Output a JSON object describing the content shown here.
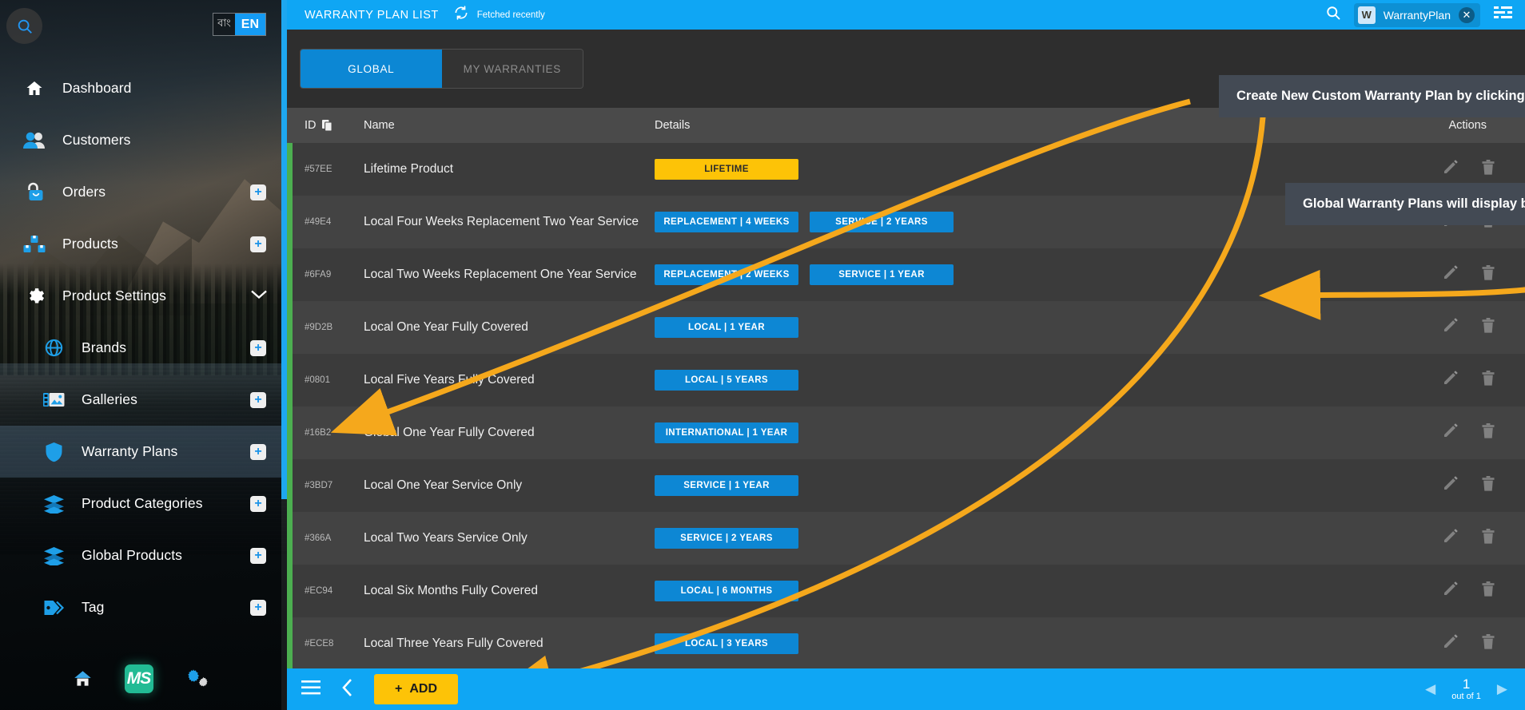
{
  "sidebar": {
    "search_icon": "search-icon",
    "language": {
      "alt_label": "বাং",
      "current": "EN"
    },
    "items": [
      {
        "label": "Dashboard",
        "icon": "home-icon",
        "add": false,
        "chevron": false,
        "sub": false,
        "active": false
      },
      {
        "label": "Customers",
        "icon": "customers-icon",
        "add": false,
        "chevron": false,
        "sub": false,
        "active": false
      },
      {
        "label": "Orders",
        "icon": "orders-icon",
        "add": true,
        "chevron": false,
        "sub": false,
        "active": false
      },
      {
        "label": "Products",
        "icon": "products-icon",
        "add": true,
        "chevron": false,
        "sub": false,
        "active": false
      },
      {
        "label": "Product Settings",
        "icon": "gear-icon",
        "add": false,
        "chevron": true,
        "sub": false,
        "active": false
      },
      {
        "label": "Brands",
        "icon": "globe-icon",
        "add": true,
        "chevron": false,
        "sub": true,
        "active": false
      },
      {
        "label": "Galleries",
        "icon": "gallery-icon",
        "add": true,
        "chevron": false,
        "sub": true,
        "active": false
      },
      {
        "label": "Warranty Plans",
        "icon": "shield-icon",
        "add": true,
        "chevron": false,
        "sub": true,
        "active": true
      },
      {
        "label": "Product Categories",
        "icon": "layers-icon",
        "add": true,
        "chevron": false,
        "sub": true,
        "active": false
      },
      {
        "label": "Global Products",
        "icon": "layers-icon",
        "add": true,
        "chevron": false,
        "sub": true,
        "active": false
      },
      {
        "label": "Tag",
        "icon": "tag-icon",
        "add": true,
        "chevron": false,
        "sub": true,
        "active": false
      }
    ],
    "plus_label": "+",
    "footer": {
      "home_icon": "home-icon",
      "brand_logo": "MS",
      "settings_icon": "double-gear-icon"
    }
  },
  "topbar": {
    "title": "WARRANTY PLAN LIST",
    "refresh_icon": "refresh-icon",
    "status": "Fetched recently",
    "search_icon": "search-icon",
    "account": {
      "initial": "W",
      "name": "WarrantyPlan",
      "close_label": "✕"
    },
    "menu_icon": "filter-list-icon",
    "accent_color": "#0fa6f4"
  },
  "tabs": [
    {
      "label": "GLOBAL",
      "active": true
    },
    {
      "label": "MY WARRANTIES",
      "active": false
    }
  ],
  "table": {
    "columns": [
      "ID",
      "Name",
      "Details",
      "Actions"
    ],
    "id_copy_icon": "copy-icon",
    "edit_icon": "pencil-icon",
    "delete_icon": "trash-icon",
    "row_accent_color": "#4caf50",
    "badge_color": "#0d87d4",
    "badge_gold_color": "#fdc307",
    "rows": [
      {
        "id": "#57EE",
        "name": "Lifetime Product",
        "badges": [
          {
            "label": "LIFETIME",
            "style": "gold"
          }
        ]
      },
      {
        "id": "#49E4",
        "name": "Local Four Weeks Replacement Two Year Service",
        "badges": [
          {
            "label": "REPLACEMENT | 4 WEEKS",
            "style": "blue"
          },
          {
            "label": "SERVICE | 2 YEARS",
            "style": "blue"
          }
        ]
      },
      {
        "id": "#6FA9",
        "name": "Local Two Weeks Replacement One Year Service",
        "badges": [
          {
            "label": "REPLACEMENT | 2 WEEKS",
            "style": "blue"
          },
          {
            "label": "SERVICE | 1 YEAR",
            "style": "blue"
          }
        ]
      },
      {
        "id": "#9D2B",
        "name": "Local One Year Fully Covered",
        "badges": [
          {
            "label": "LOCAL | 1 YEAR",
            "style": "blue"
          }
        ]
      },
      {
        "id": "#0801",
        "name": "Local Five Years Fully Covered",
        "badges": [
          {
            "label": "LOCAL | 5 YEARS",
            "style": "blue"
          }
        ]
      },
      {
        "id": "#16B2",
        "name": "Global One Year Fully Covered",
        "badges": [
          {
            "label": "INTERNATIONAL | 1 YEAR",
            "style": "blue"
          }
        ]
      },
      {
        "id": "#3BD7",
        "name": "Local One Year Service Only",
        "badges": [
          {
            "label": "SERVICE | 1 YEAR",
            "style": "blue"
          }
        ]
      },
      {
        "id": "#366A",
        "name": "Local Two Years Service Only",
        "badges": [
          {
            "label": "SERVICE | 2 YEARS",
            "style": "blue"
          }
        ]
      },
      {
        "id": "#EC94",
        "name": "Local Six Months Fully Covered",
        "badges": [
          {
            "label": "LOCAL | 6 MONTHS",
            "style": "blue"
          }
        ]
      },
      {
        "id": "#ECE8",
        "name": "Local Three Years Fully Covered",
        "badges": [
          {
            "label": "LOCAL | 3 YEARS",
            "style": "blue"
          }
        ]
      }
    ]
  },
  "annotations": [
    {
      "text": "Create New Custom Warranty Plan by clicking here"
    },
    {
      "text": "Global Warranty Plans will display by default here"
    }
  ],
  "annotation_color": "#f5a81c",
  "bottombar": {
    "menu_icon": "hamburger-icon",
    "back_icon": "chevron-left-icon",
    "add_label": "ADD",
    "add_plus": "+",
    "pagination": {
      "prev_icon": "prev-icon",
      "page": "1",
      "total_label": "out of 1",
      "next_icon": "next-icon"
    }
  }
}
